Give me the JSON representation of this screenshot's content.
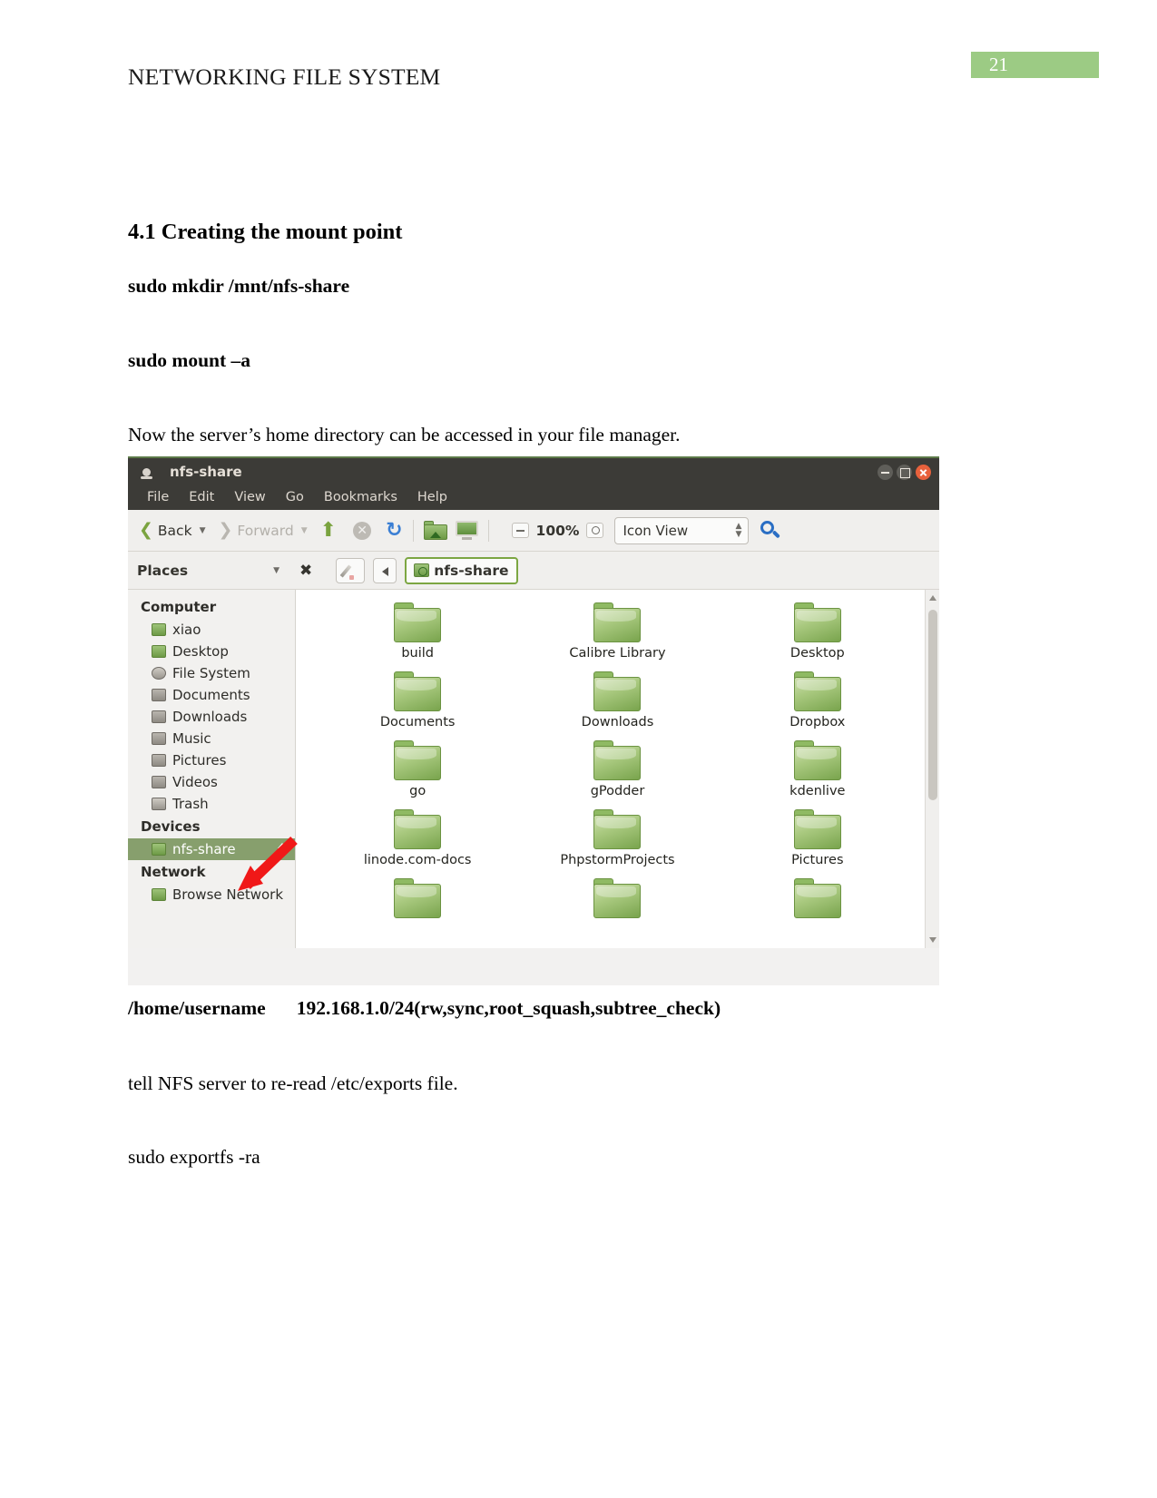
{
  "page": {
    "header_title": "NETWORKING FILE SYSTEM",
    "page_number": "21",
    "accent_green": "#9ccb84"
  },
  "document": {
    "heading": "4.1 Creating the mount point",
    "command_mkdir": "sudo mkdir /mnt/nfs-share",
    "command_mount": "sudo mount –a",
    "paragraph_now": "Now the server’s home directory can be accessed in your file manager.",
    "export_path": "/home/username",
    "export_options": "192.168.1.0/24(rw,sync,root_squash,subtree_check)",
    "paragraph_tell": "tell NFS server to re-read /etc/exports file.",
    "command_exportfs": "sudo exportfs -ra"
  },
  "file_manager": {
    "window_title": "nfs-share",
    "window_buttons": {
      "minimize": "minimize",
      "maximize": "maximize",
      "close": "close"
    },
    "menu": [
      "File",
      "Edit",
      "View",
      "Go",
      "Bookmarks",
      "Help"
    ],
    "toolbar": {
      "back_label": "Back",
      "forward_label": "Forward",
      "up_icon": "up-arrow-icon",
      "stop_icon": "stop-icon",
      "reload_icon": "reload-icon",
      "home_icon": "home-folder-icon",
      "computer_icon": "computer-icon",
      "zoom_out_icon": "zoom-out-icon",
      "zoom_level": "100%",
      "zoom_reset_icon": "zoom-reset-icon",
      "view_mode": "Icon View",
      "search_icon": "search-icon"
    },
    "places_bar": {
      "label": "Places",
      "clear_icon": "close-icon",
      "edit_icon": "pencil-icon",
      "back_icon": "left-arrow-icon",
      "breadcrumb": "nfs-share"
    },
    "sidebar": [
      {
        "type": "group",
        "label": "Computer"
      },
      {
        "type": "item",
        "label": "xiao",
        "icon": "home-icon",
        "selected": false
      },
      {
        "type": "item",
        "label": "Desktop",
        "icon": "desktop-icon",
        "selected": false
      },
      {
        "type": "item",
        "label": "File System",
        "icon": "disk-icon",
        "selected": false
      },
      {
        "type": "item",
        "label": "Documents",
        "icon": "documents-icon",
        "selected": false
      },
      {
        "type": "item",
        "label": "Downloads",
        "icon": "downloads-icon",
        "selected": false
      },
      {
        "type": "item",
        "label": "Music",
        "icon": "music-icon",
        "selected": false
      },
      {
        "type": "item",
        "label": "Pictures",
        "icon": "pictures-icon",
        "selected": false
      },
      {
        "type": "item",
        "label": "Videos",
        "icon": "videos-icon",
        "selected": false
      },
      {
        "type": "item",
        "label": "Trash",
        "icon": "trash-icon",
        "selected": false
      },
      {
        "type": "group",
        "label": "Devices"
      },
      {
        "type": "item",
        "label": "nfs-share",
        "icon": "device-icon",
        "selected": true,
        "eject": true
      },
      {
        "type": "group",
        "label": "Network"
      },
      {
        "type": "item",
        "label": "Browse Network",
        "icon": "network-icon",
        "selected": false
      }
    ],
    "folders": [
      "build",
      "Calibre Library",
      "Desktop",
      "Documents",
      "Downloads",
      "Dropbox",
      "go",
      "gPodder",
      "kdenlive",
      "linode.com-docs",
      "PhpstormProjects",
      "Pictures"
    ],
    "annotation": {
      "arrow_color": "#f01818",
      "points_to": "nfs-share"
    }
  }
}
